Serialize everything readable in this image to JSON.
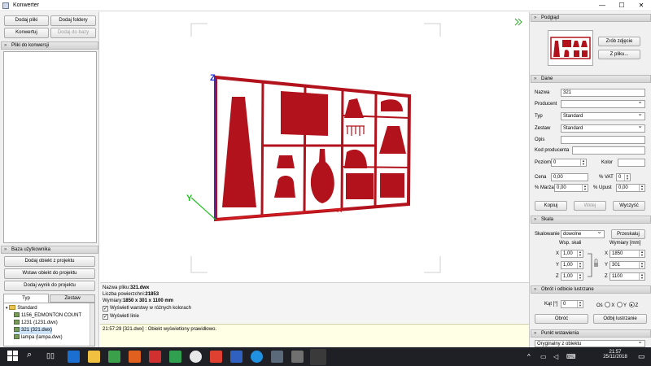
{
  "window": {
    "title": "Konwerter"
  },
  "left": {
    "buttons": {
      "add_files": "Dodaj pliki",
      "add_folders": "Dodaj foldery",
      "convert": "Konwertuj",
      "add_to_db": "Dodaj do bazy"
    },
    "files_panel_title": "Pliki do konwersji",
    "db_panel_title": "Baza użytkownika",
    "db_buttons": {
      "add_object": "Dodaj obiekt z projektu",
      "insert_object": "Wstaw obiekt do projektu",
      "add_result": "Dodaj wynik do projektu"
    },
    "tabs": [
      "Typ",
      "Zestaw"
    ],
    "tree": {
      "root": "Standard",
      "items": [
        "1156_EDMONTON COUNT",
        "1231 (1231.dwx)",
        "321 (321.dwx)",
        "lampa (lampa.dwx)"
      ]
    }
  },
  "center": {
    "info": {
      "filename_label": "Nazwa pliku:",
      "filename": "321.dwx",
      "surfaces_label": "Liczba powierzchni:",
      "surfaces": "21853",
      "dims_label": "Wymiary:",
      "dims": "1850 x 301 x 1100 mm"
    },
    "checkboxes": {
      "layers_colors": "Wyświetl warstwy w różnych kolorach",
      "lines": "Wyświetl linie"
    },
    "log": "21:57:29 [321.dwx] : Obiekt wyświetlony prawidłowo."
  },
  "right": {
    "preview": {
      "title": "Podgląd",
      "take_photo": "Zrób zdjęcie",
      "from_file": "Z pliku..."
    },
    "data": {
      "title": "Dane",
      "name_label": "Nazwa",
      "name_value": "321",
      "producer_label": "Producent",
      "producer_value": "",
      "type_label": "Typ",
      "type_value": "Standard",
      "set_label": "Zestaw",
      "set_value": "Standard",
      "desc_label": "Opis",
      "producer_code_label": "Kod producenta",
      "level_label": "Poziom",
      "level_value": "0",
      "color_label": "Kolor",
      "price_label": "Cena",
      "price_value": "0,00",
      "vat_label": "% VAT",
      "vat_value": "0",
      "margin_label": "% Marża",
      "margin_value": "0,00",
      "discount_label": "% Upust",
      "discount_value": "0,00",
      "copy_btn": "Kopiuj",
      "paste_btn": "Wklej",
      "clear_btn": "Wyczyść"
    },
    "scale": {
      "title": "Skala",
      "scaling_label": "Skalowanie",
      "scaling_value": "dowolne",
      "recalc_btn": "Przeskaluj",
      "coef_label": "Wsp. skali",
      "dims_label": "Wymiary [mm]",
      "x_label": "X",
      "y_label": "Y",
      "z_label": "Z",
      "coef_x": "1,00",
      "coef_y": "1,00",
      "coef_z": "1,00",
      "dim_x": "1850",
      "dim_y": "301",
      "dim_z": "1100"
    },
    "rotate": {
      "title": "Obrót i odbicie lustrzane",
      "angle_label": "Kąt [°]",
      "angle_value": "0",
      "axis_label": "Oś",
      "axis_x": "X",
      "axis_y": "Y",
      "axis_z": "Z",
      "rotate_btn": "Obróć",
      "mirror_btn": "Odbij lustrzanie"
    },
    "insert": {
      "title": "Punkt wstawienia",
      "value": "Oryginalny z obiektu"
    }
  },
  "taskbar": {
    "time": "21:57",
    "date": "25/11/2018"
  },
  "colors": {
    "model": "#b2121c",
    "axis_x": "#e02020",
    "axis_y": "#20c020",
    "axis_z": "#2030e0",
    "log_bg": "#ffffe6"
  }
}
